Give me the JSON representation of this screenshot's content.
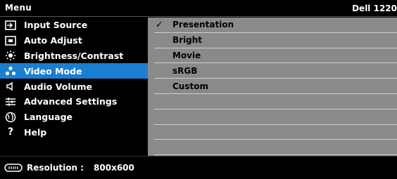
{
  "header": {
    "title": "Menu",
    "model": "Dell 1220"
  },
  "menu": {
    "items": [
      {
        "label": "Input Source",
        "icon": "input-source-icon",
        "selected": false
      },
      {
        "label": "Auto Adjust",
        "icon": "auto-adjust-icon",
        "selected": false
      },
      {
        "label": "Brightness/Contrast",
        "icon": "brightness-icon",
        "selected": false
      },
      {
        "label": "Video Mode",
        "icon": "video-mode-icon",
        "selected": true
      },
      {
        "label": "Audio Volume",
        "icon": "speaker-icon",
        "selected": false
      },
      {
        "label": "Advanced Settings",
        "icon": "sliders-icon",
        "selected": false
      },
      {
        "label": "Language",
        "icon": "globe-icon",
        "selected": false
      },
      {
        "label": "Help",
        "icon": "help-icon",
        "selected": false
      }
    ]
  },
  "video_mode": {
    "checked": "Presentation",
    "options": [
      "Presentation",
      "Bright",
      "Movie",
      "sRGB",
      "Custom"
    ],
    "check_glyph": "✓"
  },
  "status": {
    "resolution_label": "Resolution :",
    "resolution_value": "800x600",
    "icon": "display-icon"
  },
  "colors": {
    "selected_bg": "#1a7ed1",
    "panel_bg": "#8a8a8a",
    "background": "#000000"
  }
}
